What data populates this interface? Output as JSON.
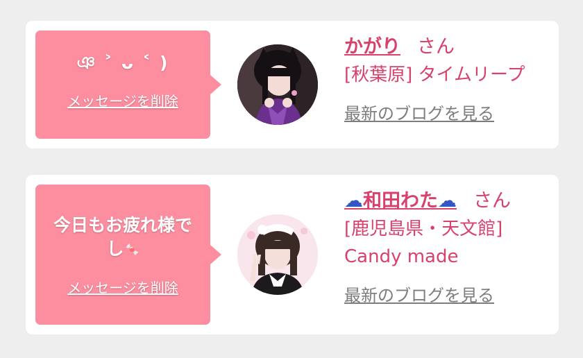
{
  "cards": [
    {
      "message": "ঞ ˃ ᴗ ˂ )",
      "message_icon": "",
      "delete_label": "メッセージを削除",
      "name_prefix": "",
      "name": "かがり",
      "name_suffix": "",
      "honorific": "さん",
      "shop": "[秋葉原] タイムリープ",
      "blog_label": "最新のブログを見る"
    },
    {
      "message": "今日もお疲れ様でし",
      "message_icon": "🍬",
      "delete_label": "メッセージを削除",
      "name_prefix": "☁",
      "name": "和田わた",
      "name_suffix": "☁",
      "honorific": "さん",
      "shop": "[鹿児島県・天文館] Candy made",
      "blog_label": "最新のブログを見る"
    }
  ],
  "colors": {
    "page_bg": "#eeeeee",
    "card_bg": "#ffffff",
    "bubble_bg": "#fd8ea0",
    "accent_text": "#d8416b",
    "link_gray": "#7d7d7d",
    "cloud_blue": "#3456c4"
  }
}
